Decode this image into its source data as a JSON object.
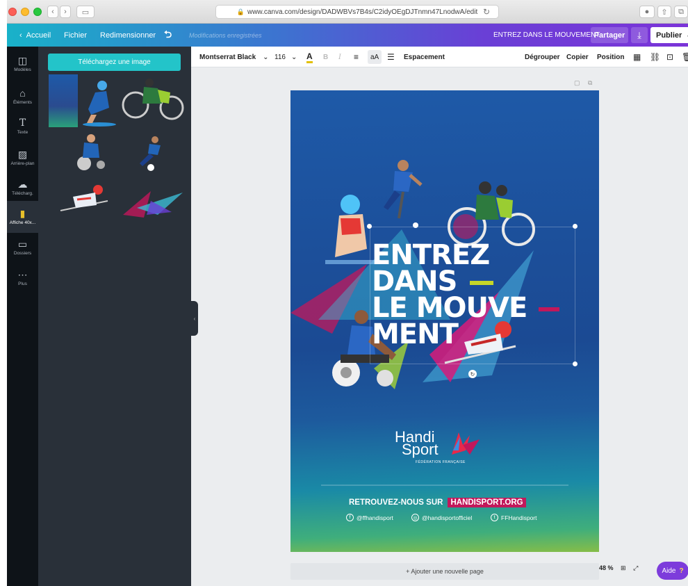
{
  "browser": {
    "url": "www.canva.com/design/DADWBVs7B4s/C2idyOEgDJTnmn47LnodwA/edit"
  },
  "topbar": {
    "back_label": "Accueil",
    "file_label": "Fichier",
    "resize_label": "Redimensionner",
    "undo_icon": "undo-icon",
    "saved_status": "Modifications enregistrées",
    "design_title": "ENTREZ DANS LE MOUVEMENT",
    "share_label": "Partager",
    "publish_label": "Publier"
  },
  "rail": {
    "items": [
      {
        "label": "Modèles",
        "icon": "layout-icon"
      },
      {
        "label": "Éléments",
        "icon": "shapes-icon"
      },
      {
        "label": "Texte",
        "icon": "text-icon"
      },
      {
        "label": "Arrière-plan",
        "icon": "pattern-icon"
      },
      {
        "label": "Télécharg.",
        "icon": "cloud-upload-icon"
      },
      {
        "label": "Affiche 40x...",
        "icon": "poster-icon"
      },
      {
        "label": "Dossiers",
        "icon": "folder-icon"
      },
      {
        "label": "Plus",
        "icon": "more-icon"
      }
    ]
  },
  "panel": {
    "upload_button": "Téléchargez une image"
  },
  "toolbar": {
    "font": "Montserrat Black",
    "font_size": "116",
    "spacing": "Espacement",
    "ungroup": "Dégrouper",
    "copy": "Copier",
    "position": "Position"
  },
  "poster": {
    "headline": [
      "ENTREZ",
      "DANS",
      "LE MOUVE",
      "MENT"
    ],
    "logo_line1": "Handi",
    "logo_line2": "Sport",
    "logo_sub": "FÉDÉRATION FRANÇAISE",
    "cta_prefix": "RETROUVEZ-NOUS SUR",
    "cta_site": "HANDISPORT.ORG",
    "social": [
      "@ffhandisport",
      "@handisportofficiel",
      "FFHandisport"
    ]
  },
  "footer": {
    "add_page": "+ Ajouter une nouvelle page",
    "zoom": "48 %",
    "help": "Aide"
  },
  "colors": {
    "accent": "#23c4c9",
    "purple": "#7b34d8",
    "magenta": "#c2185b",
    "lime": "#c5d629"
  }
}
